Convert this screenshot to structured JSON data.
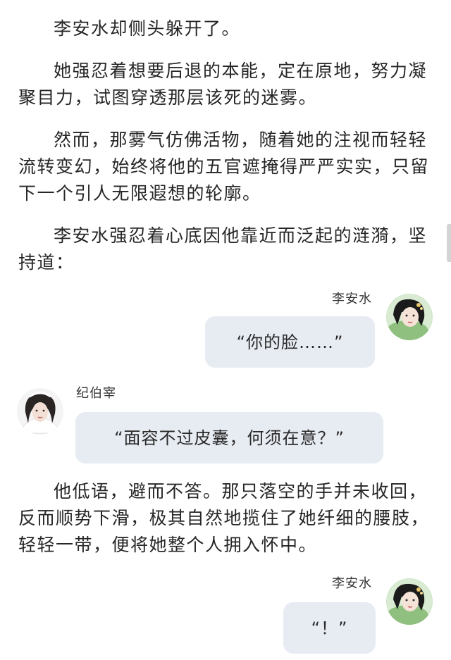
{
  "paragraphs": [
    "李安水却侧头躲开了。",
    "她强忍着想要后退的本能，定在原地，努力凝聚目力，试图穿透那层该死的迷雾。",
    "然而，那雾气仿佛活物，随着她的注视而轻轻流转变幻，始终将他的五官遮掩得严严实实，只留下一个引人无限遐想的轮廓。",
    "李安水强忍着心底因他靠近而泛起的涟漪，坚持道：",
    "他低语，避而不答。那只落空的手并未收回，反而顺势下滑，极其自然地揽住了她纤细的腰肢，轻轻一带，便将她整个人拥入怀中。"
  ],
  "chat": [
    {
      "speaker": "李安水",
      "text": "“你的脸……”",
      "side": "right",
      "avatar_icon": "female-avatar-icon"
    },
    {
      "speaker": "纪伯宰",
      "text": "“面容不过皮囊，何须在意？”",
      "side": "left",
      "avatar_icon": "male-avatar-icon"
    },
    {
      "speaker": "李安水",
      "text": "“！”",
      "side": "right",
      "avatar_icon": "female-avatar-icon"
    }
  ],
  "colors": {
    "bubble": "#e7ebf2",
    "text": "#262626",
    "background": "#ffffff"
  }
}
